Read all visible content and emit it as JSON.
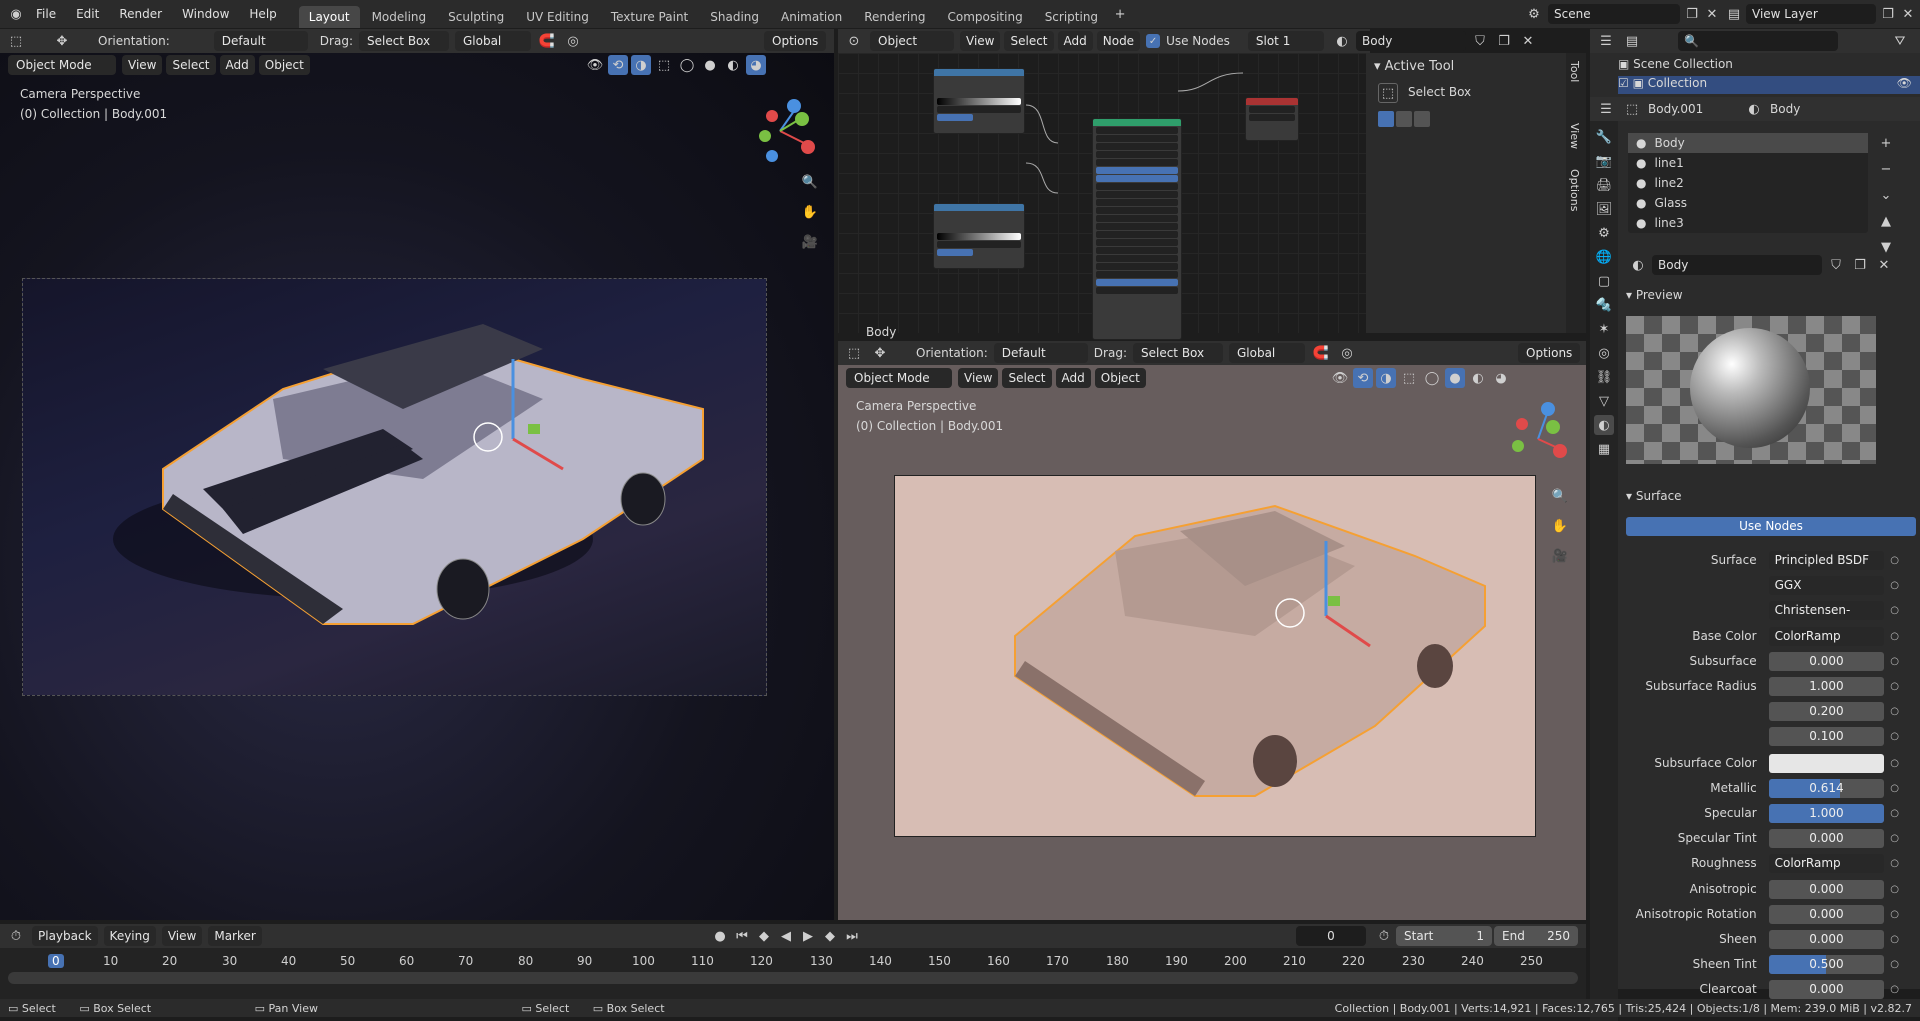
{
  "app": {
    "menus": [
      "File",
      "Edit",
      "Render",
      "Window",
      "Help"
    ],
    "workspaces": [
      "Layout",
      "Modeling",
      "Sculpting",
      "UV Editing",
      "Texture Paint",
      "Shading",
      "Animation",
      "Rendering",
      "Compositing",
      "Scripting"
    ],
    "active_workspace": "Layout",
    "scene": "Scene",
    "view_layer": "View Layer"
  },
  "left_viewport": {
    "orientation_label": "Orientation:",
    "orientation_value": "Default",
    "drag_label": "Drag:",
    "drag_value": "Select Box",
    "transform": "Global",
    "options": "Options",
    "mode": "Object Mode",
    "menus": [
      "View",
      "Select",
      "Add",
      "Object"
    ],
    "info_line1": "Camera Perspective",
    "info_line2": "(0) Collection | Body.001"
  },
  "node_editor": {
    "type": "Object",
    "menus": [
      "View",
      "Select",
      "Add",
      "Node"
    ],
    "use_nodes": "Use Nodes",
    "slot": "Slot 1",
    "material": "Body",
    "label": "Body",
    "sidebar_title": "Active Tool",
    "tool_name": "Select Box",
    "tabs": [
      "Tool",
      "View",
      "Options"
    ]
  },
  "right_viewport": {
    "orientation_label": "Orientation:",
    "orientation_value": "Default",
    "drag_label": "Drag:",
    "drag_value": "Select Box",
    "transform": "Global",
    "options": "Options",
    "mode": "Object Mode",
    "menus": [
      "View",
      "Select",
      "Add",
      "Object"
    ],
    "info_line1": "Camera Perspective",
    "info_line2": "(0) Collection | Body.001"
  },
  "outliner": {
    "scene_collection": "Scene Collection",
    "collection": "Collection"
  },
  "properties": {
    "object": "Body.001",
    "material_tab": "Body",
    "materials": [
      "Body",
      "line1",
      "line2",
      "Glass",
      "line3"
    ],
    "material_name": "Body",
    "preview": "Preview",
    "surface_section": "Surface",
    "use_nodes": "Use Nodes",
    "rows": [
      {
        "k": "Surface",
        "v": "Principled BSDF",
        "type": "dark"
      },
      {
        "k": "",
        "v": "GGX",
        "type": "dark"
      },
      {
        "k": "",
        "v": "Christensen-Burley",
        "type": "dark"
      },
      {
        "k": "Base Color",
        "v": "ColorRamp",
        "type": "dark"
      },
      {
        "k": "Subsurface",
        "v": "0.000",
        "type": "num"
      },
      {
        "k": "Subsurface Radius",
        "v": "1.000",
        "type": "num"
      },
      {
        "k": "",
        "v": "0.200",
        "type": "num"
      },
      {
        "k": "",
        "v": "0.100",
        "type": "num"
      },
      {
        "k": "Subsurface Color",
        "v": "",
        "type": "color"
      },
      {
        "k": "Metallic",
        "v": "0.614",
        "type": "fill",
        "fill": 0.614
      },
      {
        "k": "Specular",
        "v": "1.000",
        "type": "fill",
        "fill": 1.0
      },
      {
        "k": "Specular Tint",
        "v": "0.000",
        "type": "num"
      },
      {
        "k": "Roughness",
        "v": "ColorRamp",
        "type": "dark"
      },
      {
        "k": "Anisotropic",
        "v": "0.000",
        "type": "num"
      },
      {
        "k": "Anisotropic Rotation",
        "v": "0.000",
        "type": "num"
      },
      {
        "k": "Sheen",
        "v": "0.000",
        "type": "num"
      },
      {
        "k": "Sheen Tint",
        "v": "0.500",
        "type": "fill",
        "fill": 0.5
      },
      {
        "k": "Clearcoat",
        "v": "0.000",
        "type": "num"
      }
    ]
  },
  "timeline": {
    "menus": [
      "Playback",
      "Keying",
      "View",
      "Marker"
    ],
    "current_frame": "0",
    "start_label": "Start",
    "start": "1",
    "end_label": "End",
    "end": "250",
    "ticks": [
      "0",
      "10",
      "20",
      "30",
      "40",
      "50",
      "60",
      "70",
      "80",
      "90",
      "100",
      "110",
      "120",
      "130",
      "140",
      "150",
      "160",
      "170",
      "180",
      "190",
      "200",
      "210",
      "220",
      "230",
      "240",
      "250"
    ]
  },
  "statusbar": {
    "left": [
      "Select",
      "Box Select",
      "Pan View",
      "Select",
      "Box Select"
    ],
    "right": "Collection | Body.001 | Verts:14,921 | Faces:12,765 | Tris:25,424 | Objects:1/8 | Mem: 239.0 MiB | v2.82.7"
  },
  "colors": {
    "accent": "#4772b3",
    "selection": "#f5a033",
    "header": "#303030",
    "panel": "#2b2b2b"
  }
}
